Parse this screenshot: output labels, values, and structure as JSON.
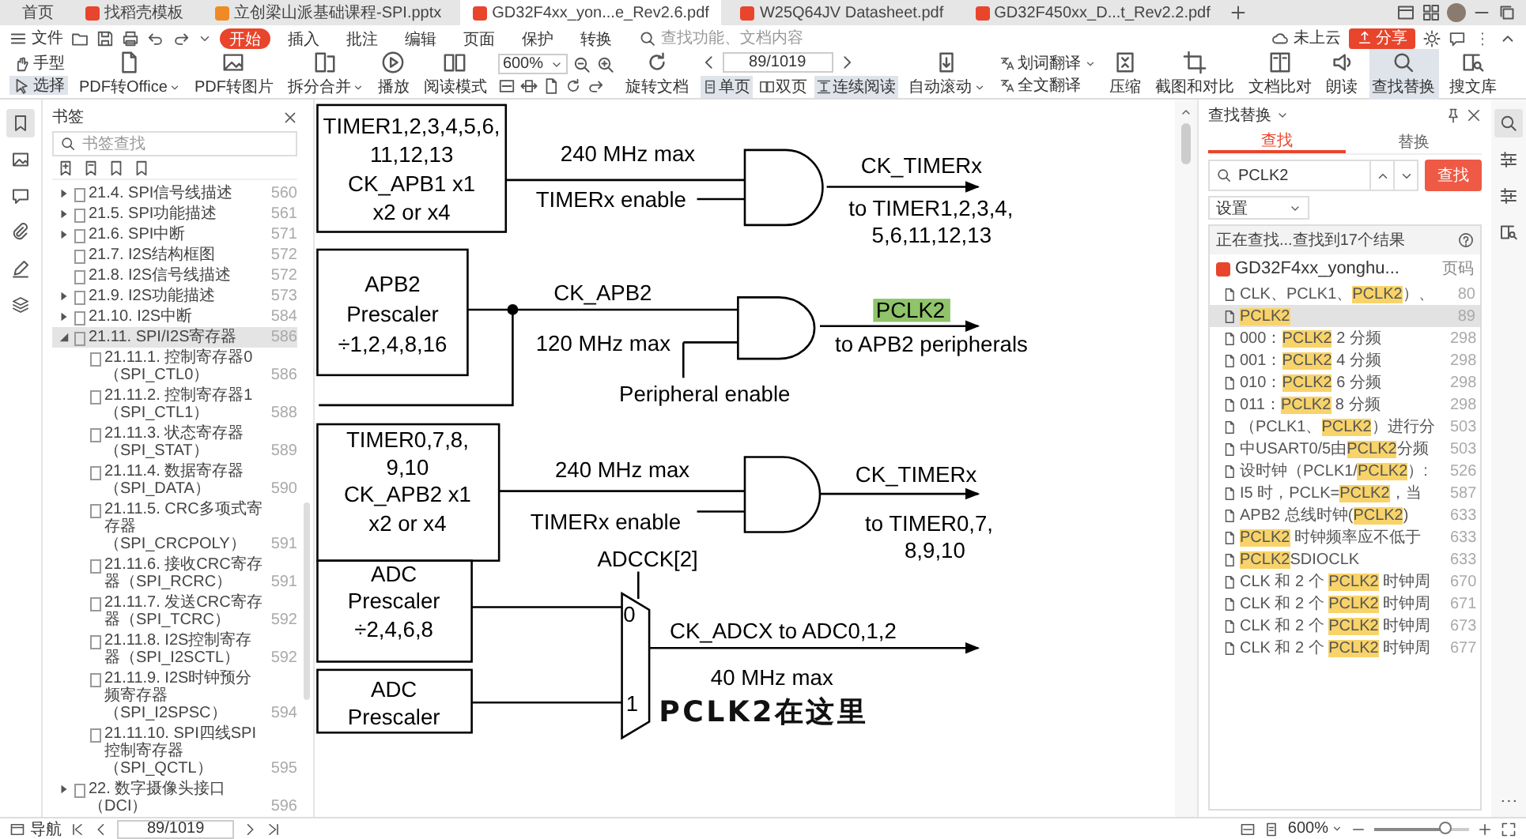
{
  "tabs": [
    {
      "label": "首页",
      "selected": false
    },
    {
      "label": "找稻壳模板",
      "selected": false
    },
    {
      "label": "立创梁山派基础课程-SPI.pptx",
      "selected": false
    },
    {
      "label": "GD32F4xx_yon...e_Rev2.6.pdf",
      "selected": true
    },
    {
      "label": "W25Q64JV Datasheet.pdf",
      "selected": false
    },
    {
      "label": "GD32F450xx_D...t_Rev2.2.pdf",
      "selected": false
    }
  ],
  "menu": {
    "file": "文件",
    "items": [
      {
        "label": "开始",
        "selected": true
      },
      {
        "label": "插入",
        "selected": false
      },
      {
        "label": "批注",
        "selected": false
      },
      {
        "label": "编辑",
        "selected": false
      },
      {
        "label": "页面",
        "selected": false
      },
      {
        "label": "保护",
        "selected": false
      },
      {
        "label": "转换",
        "selected": false
      }
    ],
    "search": {
      "placeholder": "查找功能、文档内容"
    },
    "cloud": "未上云",
    "share": "分享"
  },
  "toolbar": {
    "modes": [
      {
        "label": "手型",
        "selected": false
      },
      {
        "label": "选择",
        "selected": true
      }
    ],
    "tools_left": [
      {
        "label": "PDF转Office",
        "dropdown": true,
        "selected": false
      },
      {
        "label": "PDF转图片",
        "dropdown": false,
        "selected": false
      },
      {
        "label": "拆分合并",
        "dropdown": true,
        "selected": false
      },
      {
        "label": "播放",
        "dropdown": false,
        "selected": false
      },
      {
        "label": "阅读模式",
        "dropdown": false,
        "selected": false
      }
    ],
    "zoom": "600%",
    "rotate": "旋转文档",
    "page": "89/1019",
    "views": [
      {
        "label": "单页",
        "selected": true
      },
      {
        "label": "双页",
        "selected": false
      },
      {
        "label": "连续阅读",
        "selected": true
      }
    ],
    "tools_right": [
      {
        "label": "自动滚动",
        "dropdown": true,
        "selected": false
      },
      {
        "label": "划词翻译",
        "dropdown": true,
        "selected": false
      },
      {
        "label": "全文翻译",
        "dropdown": false,
        "selected": false
      },
      {
        "label": "压缩",
        "dropdown": false,
        "selected": false
      },
      {
        "label": "截图和对比",
        "dropdown": false,
        "selected": false
      },
      {
        "label": "文档比对",
        "dropdown": false,
        "selected": false
      },
      {
        "label": "朗读",
        "dropdown": false,
        "selected": false
      },
      {
        "label": "查找替换",
        "dropdown": false,
        "selected": true
      },
      {
        "label": "搜文库",
        "dropdown": false,
        "selected": false
      }
    ]
  },
  "bookmarks": {
    "title": "书签",
    "search": {
      "placeholder": "书签查找"
    },
    "items": [
      {
        "label": "21.4. SPI信号线描述",
        "page": "560",
        "expanded": false,
        "selected": false
      },
      {
        "label": "21.5. SPI功能描述",
        "page": "561",
        "expanded": false,
        "selected": false
      },
      {
        "label": "21.6. SPI中断",
        "page": "571",
        "expanded": false,
        "selected": false
      },
      {
        "label": "21.7. I2S结构框图",
        "page": "572",
        "selected": false
      },
      {
        "label": "21.8. I2S信号线描述",
        "page": "572",
        "selected": false
      },
      {
        "label": "21.9. I2S功能描述",
        "page": "573",
        "expanded": false,
        "selected": false
      },
      {
        "label": "21.10. I2S中断",
        "page": "584",
        "expanded": false,
        "selected": false
      },
      {
        "label": "21.11. SPI/I2S寄存器",
        "page": "586",
        "expanded": true,
        "selected": true,
        "children": [
          {
            "label": "21.11.1. 控制寄存器0（SPI_CTL0）",
            "page": "586",
            "selected": false
          },
          {
            "label": "21.11.2. 控制寄存器1（SPI_CTL1）",
            "page": "588",
            "selected": false
          },
          {
            "label": "21.11.3. 状态寄存器（SPI_STAT）",
            "page": "589",
            "selected": false
          },
          {
            "label": "21.11.4. 数据寄存器（SPI_DATA）",
            "page": "590",
            "selected": false
          },
          {
            "label": "21.11.5. CRC多项式寄存器（SPI_CRCPOLY）",
            "page": "591",
            "selected": false
          },
          {
            "label": "21.11.6. 接收CRC寄存器（SPI_RCRC）",
            "page": "591",
            "selected": false
          },
          {
            "label": "21.11.7. 发送CRC寄存器（SPI_TCRC）",
            "page": "592",
            "selected": false
          },
          {
            "label": "21.11.8. I2S控制寄存器（SPI_I2SCTL）",
            "page": "592",
            "selected": false
          },
          {
            "label": "21.11.9. I2S时钟预分频寄存器（SPI_I2SPSC）",
            "page": "594",
            "selected": false
          },
          {
            "label": "21.11.10. SPI四线SPI控制寄存器（SPI_QCTL）",
            "page": "595",
            "selected": false
          }
        ]
      },
      {
        "label": "22. 数字摄像头接口（DCI）",
        "page": "596",
        "expanded": false,
        "selected": false
      }
    ]
  },
  "diagram": {
    "blocks": [
      {
        "lines": [
          "TIMER1,2,3,4,5,6,",
          "11,12,13",
          "CK_APB1 x1",
          "x2 or x4"
        ]
      },
      {
        "lines": [
          "APB2",
          "Prescaler",
          "÷1,2,4,8,16"
        ]
      },
      {
        "lines": [
          "TIMER0,7,8,",
          "9,10",
          "CK_APB2 x1",
          "x2 or x4"
        ]
      },
      {
        "lines": [
          "ADC",
          "Prescaler",
          "÷2,4,6,8"
        ]
      },
      {
        "lines": [
          "ADC",
          "Prescaler"
        ]
      }
    ],
    "labels": [
      {
        "text": "240 MHz max",
        "highlight": false
      },
      {
        "text": "TIMERx enable",
        "highlight": false
      },
      {
        "text": "CK_TIMERx",
        "highlight": false
      },
      {
        "text": "to TIMER1,2,3,4,",
        "highlight": false
      },
      {
        "text": "5,6,11,12,13",
        "highlight": false
      },
      {
        "text": "CK_APB2",
        "highlight": false
      },
      {
        "text": "120 MHz max",
        "highlight": false
      },
      {
        "text": "PCLK2",
        "highlight": true
      },
      {
        "text": "to APB2 peripherals",
        "highlight": false
      },
      {
        "text": "Peripheral enable",
        "highlight": false
      },
      {
        "text": "240 MHz max",
        "highlight": false
      },
      {
        "text": "TIMERx enable",
        "highlight": false
      },
      {
        "text": "CK_TIMERx",
        "highlight": false
      },
      {
        "text": "to TIMER0,7,",
        "highlight": false
      },
      {
        "text": "8,9,10",
        "highlight": false
      },
      {
        "text": "CK_ADCX to ADC0,1,2",
        "highlight": false
      },
      {
        "text": "40 MHz max",
        "highlight": false
      }
    ],
    "mux": {
      "select": "ADCCK[2]",
      "inputs": [
        "0",
        "1"
      ]
    },
    "subtitle": "PCLK2在这里"
  },
  "find_panel": {
    "title": "查找替换",
    "tabs": [
      {
        "label": "查找",
        "selected": true
      },
      {
        "label": "替换",
        "selected": false
      }
    ],
    "query": "PCLK2",
    "button": "查找",
    "settings": "设置",
    "status": "正在查找...查找到17个结果",
    "file": "GD32F4xx_yonghu...",
    "page_header": "页码",
    "results": [
      {
        "parts": [
          {
            "text": "CLK、PCLK1、",
            "highlight": false
          },
          {
            "text": "PCLK2",
            "highlight": true
          },
          {
            "text": "）、",
            "highlight": false
          }
        ],
        "page": "80",
        "selected": false
      },
      {
        "parts": [
          {
            "text": "PCLK2",
            "highlight": true
          }
        ],
        "page": "89",
        "selected": true
      },
      {
        "parts": [
          {
            "text": "000：",
            "highlight": false
          },
          {
            "text": "PCLK2",
            "highlight": true
          },
          {
            "text": " 2 分频",
            "highlight": false
          }
        ],
        "page": "298",
        "selected": false
      },
      {
        "parts": [
          {
            "text": "001：",
            "highlight": false
          },
          {
            "text": "PCLK2",
            "highlight": true
          },
          {
            "text": " 4 分频",
            "highlight": false
          }
        ],
        "page": "298",
        "selected": false
      },
      {
        "parts": [
          {
            "text": "010：",
            "highlight": false
          },
          {
            "text": "PCLK2",
            "highlight": true
          },
          {
            "text": " 6 分频",
            "highlight": false
          }
        ],
        "page": "298",
        "selected": false
      },
      {
        "parts": [
          {
            "text": "011：",
            "highlight": false
          },
          {
            "text": "PCLK2",
            "highlight": true
          },
          {
            "text": " 8 分频",
            "highlight": false
          }
        ],
        "page": "298",
        "selected": false
      },
      {
        "parts": [
          {
            "text": "（PCLK1、",
            "highlight": false
          },
          {
            "text": "PCLK2",
            "highlight": true
          },
          {
            "text": "）进行分",
            "highlight": false
          }
        ],
        "page": "503",
        "selected": false
      },
      {
        "parts": [
          {
            "text": "中USART0/5由",
            "highlight": false
          },
          {
            "text": "PCLK2",
            "highlight": true
          },
          {
            "text": "分频",
            "highlight": false
          }
        ],
        "page": "503",
        "selected": false
      },
      {
        "parts": [
          {
            "text": "设时钟（PCLK1/",
            "highlight": false
          },
          {
            "text": "PCLK2",
            "highlight": true
          },
          {
            "text": "）:",
            "highlight": false
          }
        ],
        "page": "526",
        "selected": false
      },
      {
        "parts": [
          {
            "text": "I5 时，PCLK=",
            "highlight": false
          },
          {
            "text": "PCLK2",
            "highlight": true
          },
          {
            "text": "，当",
            "highlight": false
          }
        ],
        "page": "587",
        "selected": false
      },
      {
        "parts": [
          {
            "text": "APB2 总线时钟(",
            "highlight": false
          },
          {
            "text": "PCLK2",
            "highlight": true
          },
          {
            "text": ")",
            "highlight": false
          }
        ],
        "page": "633",
        "selected": false
      },
      {
        "parts": [
          {
            "text": "PCLK2",
            "highlight": true
          },
          {
            "text": " 时钟频率应不低于",
            "highlight": false
          }
        ],
        "page": "633",
        "selected": false
      },
      {
        "parts": [
          {
            "text": "PCLK2",
            "highlight": true
          },
          {
            "text": "SDIOCLK",
            "highlight": false
          }
        ],
        "page": "633",
        "selected": false
      },
      {
        "parts": [
          {
            "text": "CLK 和 2 个 ",
            "highlight": false
          },
          {
            "text": "PCLK2",
            "highlight": true
          },
          {
            "text": " 时钟周",
            "highlight": false
          }
        ],
        "page": "670",
        "selected": false
      },
      {
        "parts": [
          {
            "text": "CLK 和 2 个 ",
            "highlight": false
          },
          {
            "text": "PCLK2",
            "highlight": true
          },
          {
            "text": " 时钟周",
            "highlight": false
          }
        ],
        "page": "671",
        "selected": false
      },
      {
        "parts": [
          {
            "text": "CLK 和 2 个 ",
            "highlight": false
          },
          {
            "text": "PCLK2",
            "highlight": true
          },
          {
            "text": " 时钟周",
            "highlight": false
          }
        ],
        "page": "673",
        "selected": false
      },
      {
        "parts": [
          {
            "text": "CLK 和 2 个 ",
            "highlight": false
          },
          {
            "text": "PCLK2",
            "highlight": true
          },
          {
            "text": " 时钟周",
            "highlight": false
          }
        ],
        "page": "677",
        "selected": false
      }
    ]
  },
  "status_bar": {
    "nav": "导航",
    "page": "89/1019",
    "zoom": "600%",
    "zoom_slider": {
      "level": 0.75
    }
  }
}
